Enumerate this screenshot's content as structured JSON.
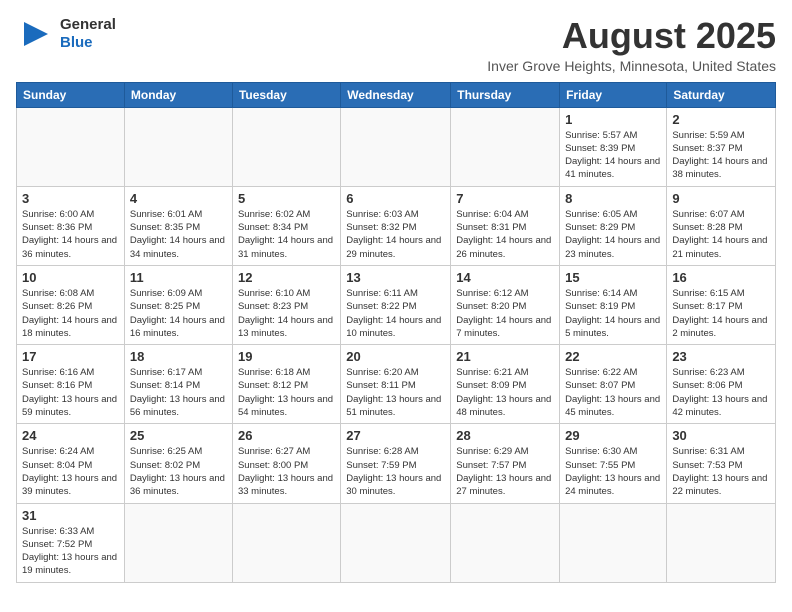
{
  "header": {
    "logo_general": "General",
    "logo_blue": "Blue",
    "month_title": "August 2025",
    "location": "Inver Grove Heights, Minnesota, United States"
  },
  "weekdays": [
    "Sunday",
    "Monday",
    "Tuesday",
    "Wednesday",
    "Thursday",
    "Friday",
    "Saturday"
  ],
  "weeks": [
    [
      {
        "day": "",
        "info": ""
      },
      {
        "day": "",
        "info": ""
      },
      {
        "day": "",
        "info": ""
      },
      {
        "day": "",
        "info": ""
      },
      {
        "day": "",
        "info": ""
      },
      {
        "day": "1",
        "info": "Sunrise: 5:57 AM\nSunset: 8:39 PM\nDaylight: 14 hours and 41 minutes."
      },
      {
        "day": "2",
        "info": "Sunrise: 5:59 AM\nSunset: 8:37 PM\nDaylight: 14 hours and 38 minutes."
      }
    ],
    [
      {
        "day": "3",
        "info": "Sunrise: 6:00 AM\nSunset: 8:36 PM\nDaylight: 14 hours and 36 minutes."
      },
      {
        "day": "4",
        "info": "Sunrise: 6:01 AM\nSunset: 8:35 PM\nDaylight: 14 hours and 34 minutes."
      },
      {
        "day": "5",
        "info": "Sunrise: 6:02 AM\nSunset: 8:34 PM\nDaylight: 14 hours and 31 minutes."
      },
      {
        "day": "6",
        "info": "Sunrise: 6:03 AM\nSunset: 8:32 PM\nDaylight: 14 hours and 29 minutes."
      },
      {
        "day": "7",
        "info": "Sunrise: 6:04 AM\nSunset: 8:31 PM\nDaylight: 14 hours and 26 minutes."
      },
      {
        "day": "8",
        "info": "Sunrise: 6:05 AM\nSunset: 8:29 PM\nDaylight: 14 hours and 23 minutes."
      },
      {
        "day": "9",
        "info": "Sunrise: 6:07 AM\nSunset: 8:28 PM\nDaylight: 14 hours and 21 minutes."
      }
    ],
    [
      {
        "day": "10",
        "info": "Sunrise: 6:08 AM\nSunset: 8:26 PM\nDaylight: 14 hours and 18 minutes."
      },
      {
        "day": "11",
        "info": "Sunrise: 6:09 AM\nSunset: 8:25 PM\nDaylight: 14 hours and 16 minutes."
      },
      {
        "day": "12",
        "info": "Sunrise: 6:10 AM\nSunset: 8:23 PM\nDaylight: 14 hours and 13 minutes."
      },
      {
        "day": "13",
        "info": "Sunrise: 6:11 AM\nSunset: 8:22 PM\nDaylight: 14 hours and 10 minutes."
      },
      {
        "day": "14",
        "info": "Sunrise: 6:12 AM\nSunset: 8:20 PM\nDaylight: 14 hours and 7 minutes."
      },
      {
        "day": "15",
        "info": "Sunrise: 6:14 AM\nSunset: 8:19 PM\nDaylight: 14 hours and 5 minutes."
      },
      {
        "day": "16",
        "info": "Sunrise: 6:15 AM\nSunset: 8:17 PM\nDaylight: 14 hours and 2 minutes."
      }
    ],
    [
      {
        "day": "17",
        "info": "Sunrise: 6:16 AM\nSunset: 8:16 PM\nDaylight: 13 hours and 59 minutes."
      },
      {
        "day": "18",
        "info": "Sunrise: 6:17 AM\nSunset: 8:14 PM\nDaylight: 13 hours and 56 minutes."
      },
      {
        "day": "19",
        "info": "Sunrise: 6:18 AM\nSunset: 8:12 PM\nDaylight: 13 hours and 54 minutes."
      },
      {
        "day": "20",
        "info": "Sunrise: 6:20 AM\nSunset: 8:11 PM\nDaylight: 13 hours and 51 minutes."
      },
      {
        "day": "21",
        "info": "Sunrise: 6:21 AM\nSunset: 8:09 PM\nDaylight: 13 hours and 48 minutes."
      },
      {
        "day": "22",
        "info": "Sunrise: 6:22 AM\nSunset: 8:07 PM\nDaylight: 13 hours and 45 minutes."
      },
      {
        "day": "23",
        "info": "Sunrise: 6:23 AM\nSunset: 8:06 PM\nDaylight: 13 hours and 42 minutes."
      }
    ],
    [
      {
        "day": "24",
        "info": "Sunrise: 6:24 AM\nSunset: 8:04 PM\nDaylight: 13 hours and 39 minutes."
      },
      {
        "day": "25",
        "info": "Sunrise: 6:25 AM\nSunset: 8:02 PM\nDaylight: 13 hours and 36 minutes."
      },
      {
        "day": "26",
        "info": "Sunrise: 6:27 AM\nSunset: 8:00 PM\nDaylight: 13 hours and 33 minutes."
      },
      {
        "day": "27",
        "info": "Sunrise: 6:28 AM\nSunset: 7:59 PM\nDaylight: 13 hours and 30 minutes."
      },
      {
        "day": "28",
        "info": "Sunrise: 6:29 AM\nSunset: 7:57 PM\nDaylight: 13 hours and 27 minutes."
      },
      {
        "day": "29",
        "info": "Sunrise: 6:30 AM\nSunset: 7:55 PM\nDaylight: 13 hours and 24 minutes."
      },
      {
        "day": "30",
        "info": "Sunrise: 6:31 AM\nSunset: 7:53 PM\nDaylight: 13 hours and 22 minutes."
      }
    ],
    [
      {
        "day": "31",
        "info": "Sunrise: 6:33 AM\nSunset: 7:52 PM\nDaylight: 13 hours and 19 minutes."
      },
      {
        "day": "",
        "info": ""
      },
      {
        "day": "",
        "info": ""
      },
      {
        "day": "",
        "info": ""
      },
      {
        "day": "",
        "info": ""
      },
      {
        "day": "",
        "info": ""
      },
      {
        "day": "",
        "info": ""
      }
    ]
  ]
}
